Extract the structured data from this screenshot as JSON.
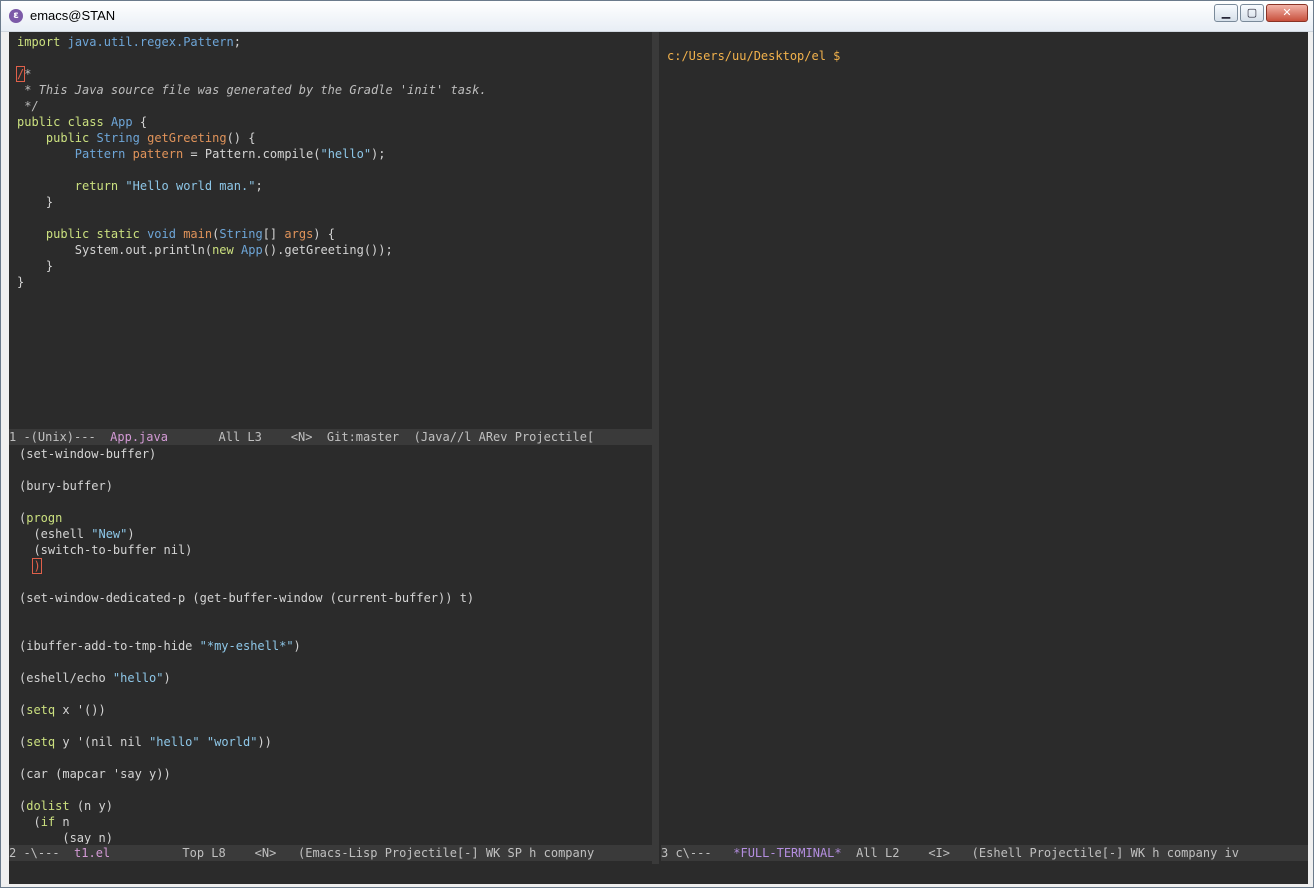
{
  "window": {
    "title": "emacs@STAN",
    "icon": "emacs-icon",
    "buttons": {
      "minimize": "▁",
      "maximize": "▢",
      "close": "✕"
    }
  },
  "java_buffer": {
    "lines": [
      "import java.util.regex.Pattern;",
      "",
      "/*",
      " * This Java source file was generated by the Gradle 'init' task.",
      " */",
      "public class App {",
      "    public String getGreeting() {",
      "        Pattern pattern = Pattern.compile(\"hello\");",
      "",
      "        return \"Hello world man.\";",
      "    }",
      "",
      "    public static void main(String[] args) {",
      "        System.out.println(new App().getGreeting());",
      "    }",
      "}"
    ]
  },
  "elisp_buffer": {
    "lines": [
      "(set-window-buffer)",
      "",
      "(bury-buffer)",
      "",
      "(progn",
      "  (eshell \"New\")",
      "  (switch-to-buffer nil)",
      "  )",
      "",
      "(set-window-dedicated-p (get-buffer-window (current-buffer)) t)",
      "",
      "",
      "(ibuffer-add-to-tmp-hide \"*my-eshell*\")",
      "",
      "(eshell/echo \"hello\")",
      "",
      "(setq x '())",
      "",
      "(setq y '(nil nil \"hello\" \"world\"))",
      "",
      "(car (mapcar 'say y))",
      "",
      "(dolist (n y)",
      "  (if n",
      "      (say n)"
    ]
  },
  "eshell": {
    "prompt": "c:/Users/uu/Desktop/el $"
  },
  "modelines": {
    "top": {
      "prefix": "1 -(Unix)---  ",
      "buffer": "App.java",
      "rest": "       All L3    <N>  Git:master  (Java//l ARev Projectile["
    },
    "bottom_left": {
      "prefix": "2 -\\---  ",
      "buffer": "t1.el",
      "rest": "          Top L8    <N>   (Emacs-Lisp Projectile[-] WK SP h company"
    },
    "bottom_right": {
      "prefix": "3 c\\---   ",
      "buffer": "*FULL-TERMINAL*",
      "rest": "  All L2    <I>   (Eshell Projectile[-] WK h company iv"
    }
  }
}
